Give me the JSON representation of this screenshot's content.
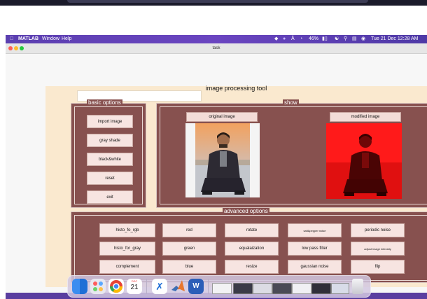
{
  "menubar": {
    "app_name": "MATLAB",
    "items": [
      "Window",
      "Help"
    ],
    "battery": "46%",
    "clock": "Tue 21 Dec  12:28 AM"
  },
  "window": {
    "title": "task"
  },
  "app": {
    "title": "image processing tool",
    "basic_options": {
      "title": "basic options",
      "buttons": [
        "import image",
        "gray shade",
        "black&white",
        "reset",
        "exit"
      ]
    },
    "show": {
      "title": "show",
      "original_label": "original image",
      "modified_label": "modified image"
    },
    "advanced_options": {
      "title": "advanced options",
      "rows": [
        [
          "histo_fo_rgb",
          "red",
          "rotate",
          "salt&pepper noise",
          "periodic noise"
        ],
        [
          "histo_for_gray",
          "green",
          "equalaization",
          "low pass filter",
          "adjust image intensity"
        ],
        [
          "complement",
          "blue",
          "resize",
          "gaussian noise",
          "flip"
        ]
      ]
    }
  },
  "dock": {
    "calendar_month": "DEC",
    "calendar_day": "21"
  },
  "colors": {
    "panel_bg": "#fae9cf",
    "group_bg": "#87514f",
    "button_bg": "#f7e4e1",
    "modified_tint": "#ff0000"
  }
}
